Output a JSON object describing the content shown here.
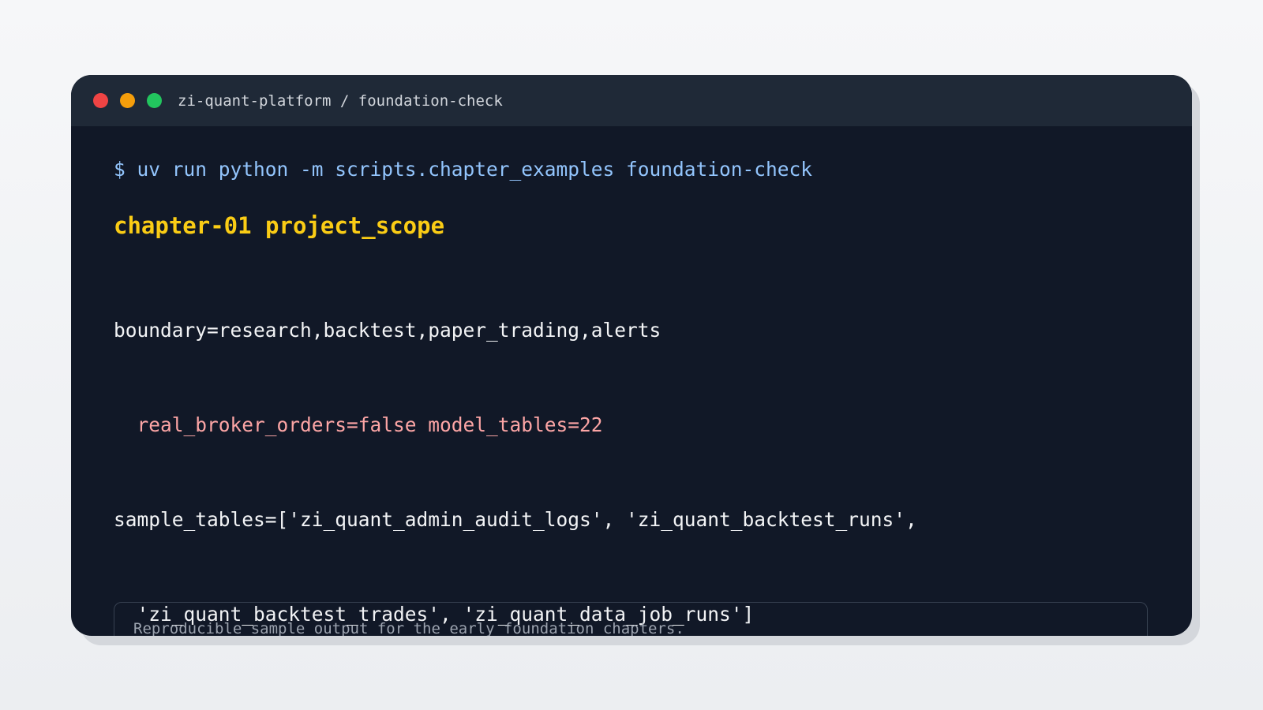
{
  "window": {
    "title": "zi-quant-platform / foundation-check",
    "controls": [
      "close",
      "minimize",
      "maximize"
    ]
  },
  "terminal": {
    "command": "$ uv run python -m scripts.chapter_examples foundation-check",
    "heading": "chapter-01 project_scope",
    "output_lines": [
      "boundary=research,backtest,paper_trading,alerts",
      "  real_broker_orders=false model_tables=22",
      "sample_tables=['zi_quant_admin_audit_logs', 'zi_quant_backtest_runs',",
      "  'zi_quant_backtest_trades', 'zi_quant_data_job_runs']"
    ]
  },
  "footer_note": "Reproducible sample output for the early foundation chapters.",
  "colors": {
    "command": "#93c5fd",
    "heading": "#facc15",
    "output": "#f3f4f6",
    "highlight": "#fca5a5",
    "terminal_bg": "#111827",
    "titlebar_bg": "#1f2937"
  }
}
